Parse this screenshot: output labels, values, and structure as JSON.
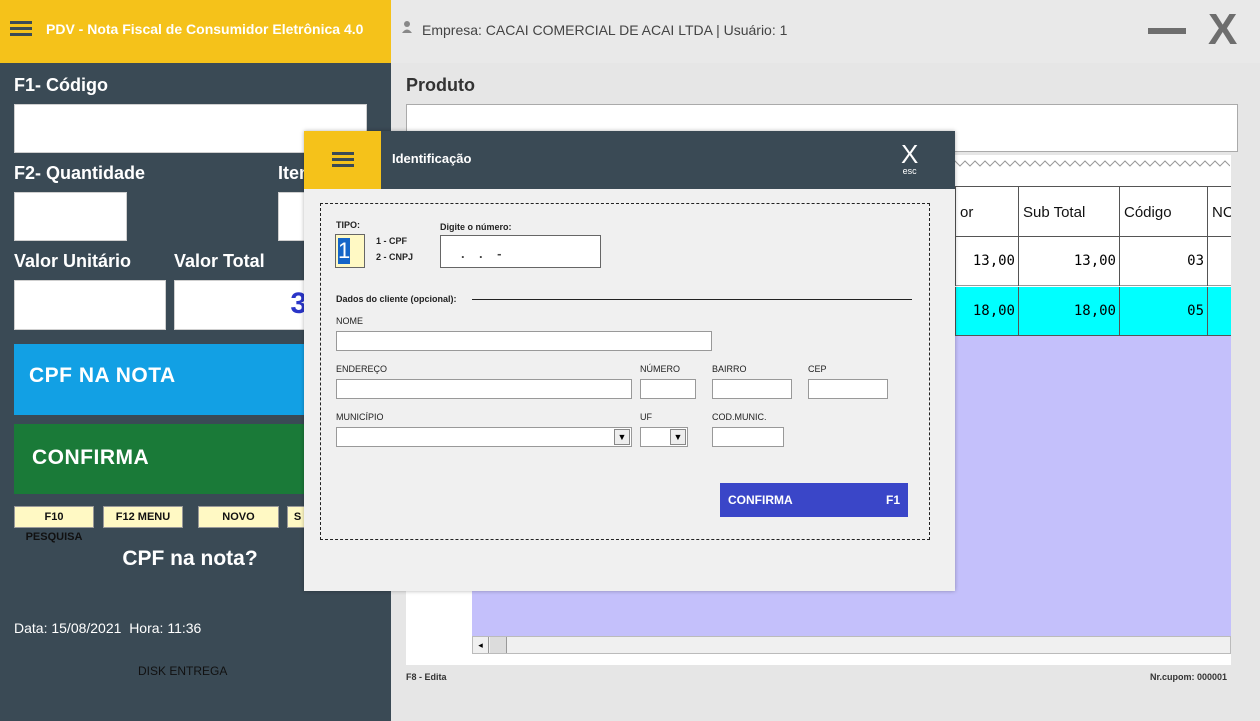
{
  "header": {
    "title": "PDV - Nota Fiscal de Consumidor Eletrônica 4.0",
    "company": "Empresa: CACAI COMERCIAL DE ACAI LTDA | Usuário: 1",
    "close_label": "X"
  },
  "left": {
    "codigo_label": "F1- Código",
    "quantidade_label": "F2- Quantidade",
    "item_label": "Item",
    "valor_unitario_label": "Valor Unitário",
    "valor_total_label": "Valor Total",
    "valor_total_partial": "3",
    "cpf_button": "CPF NA NOTA",
    "confirma_button": "CONFIRMA",
    "small_buttons": [
      "F10 PESQUISA",
      "F12 MENU",
      "NOVO",
      "S"
    ],
    "prompt": "CPF na nota?",
    "date_time": "Data: 15/08/2021  Hora: 11:36",
    "footer": "DISK ENTREGA"
  },
  "right": {
    "produto_label": "Produto",
    "columns": [
      "or",
      "Sub Total",
      "Código",
      "NC"
    ],
    "rows": [
      {
        "valor": "13,00",
        "subtotal": "13,00",
        "codigo": "03"
      },
      {
        "valor": "18,00",
        "subtotal": "18,00",
        "codigo": "05"
      }
    ],
    "f8": "F8 - Edita",
    "cupom": "Nr.cupom: 000001"
  },
  "modal": {
    "title": "Identificação",
    "close": "X",
    "close_hint": "esc",
    "tipo_label": "TIPO:",
    "tipo_value": "1",
    "tipo_opt1": "1 - CPF",
    "tipo_opt2": "2 - CNPJ",
    "numero_label": "Digite o número:",
    "numero_mask": ".    .    -",
    "dados_label": "Dados do cliente (opcional):",
    "nome_label": "NOME",
    "endereco_label": "ENDEREÇO",
    "numero_field_label": "NÚMERO",
    "bairro_label": "BAIRRO",
    "cep_label": "CEP",
    "municipio_label": "MUNICÍPIO",
    "uf_label": "UF",
    "codmunic_label": "COD.MUNIC.",
    "confirma_label": "CONFIRMA",
    "confirma_key": "F1"
  },
  "colors": {
    "yellow": "#f5c21a",
    "dark": "#3a4a55",
    "cpf_blue": "#12a0e4",
    "confirma_green": "#1a7a38",
    "row_cyan": "#00ffff",
    "grid_lilac": "#c4c0fb",
    "modal_confirm": "#3a46c8"
  }
}
